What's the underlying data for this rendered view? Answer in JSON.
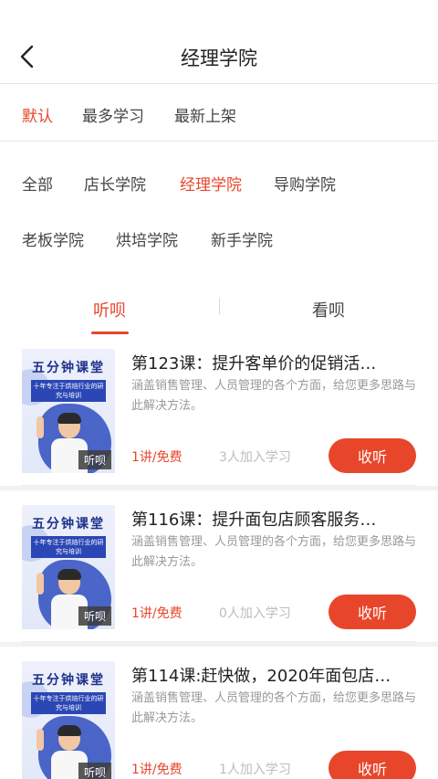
{
  "header": {
    "title": "经理学院"
  },
  "sort": {
    "items": [
      "默认",
      "最多学习",
      "最新上架"
    ],
    "active": 0
  },
  "categories": {
    "items": [
      "全部",
      "店长学院",
      "经理学院",
      "导购学院",
      "老板学院",
      "烘培学院",
      "新手学院"
    ],
    "active": 2
  },
  "tabs": {
    "items": [
      "听呗",
      "看呗"
    ],
    "active": 0
  },
  "courses": [
    {
      "thumb_title": "五分钟课堂",
      "thumb_subtitle": "十年专注于烘焙行业的研究与培训",
      "thumb_badge": "听呗",
      "title": "第123课：提升客单价的促销活…",
      "desc": "涵盖销售管理、人员管理的各个方面，给您更多思路与此解决方法。",
      "price": "1讲/免费",
      "joined": "3人加入学习",
      "button": "收听"
    },
    {
      "thumb_title": "五分钟课堂",
      "thumb_subtitle": "十年专注于烘焙行业的研究与培训",
      "thumb_badge": "听呗",
      "title": "第116课：提升面包店顾客服务…",
      "desc": "涵盖销售管理、人员管理的各个方面，给您更多思路与此解决方法。",
      "price": "1讲/免费",
      "joined": "0人加入学习",
      "button": "收听"
    },
    {
      "thumb_title": "五分钟课堂",
      "thumb_subtitle": "十年专注于烘焙行业的研究与培训",
      "thumb_badge": "听呗",
      "title": "第114课:赶快做，2020年面包店…",
      "desc": "涵盖销售管理、人员管理的各个方面，给您更多思路与此解决方法。",
      "price": "1讲/免费",
      "joined": "1人加入学习",
      "button": "收听"
    }
  ],
  "colors": {
    "accent": "#e8462b",
    "muted": "#999999",
    "divider": "#e6e6e6"
  },
  "icons": {
    "back": "chevron-left-icon"
  }
}
